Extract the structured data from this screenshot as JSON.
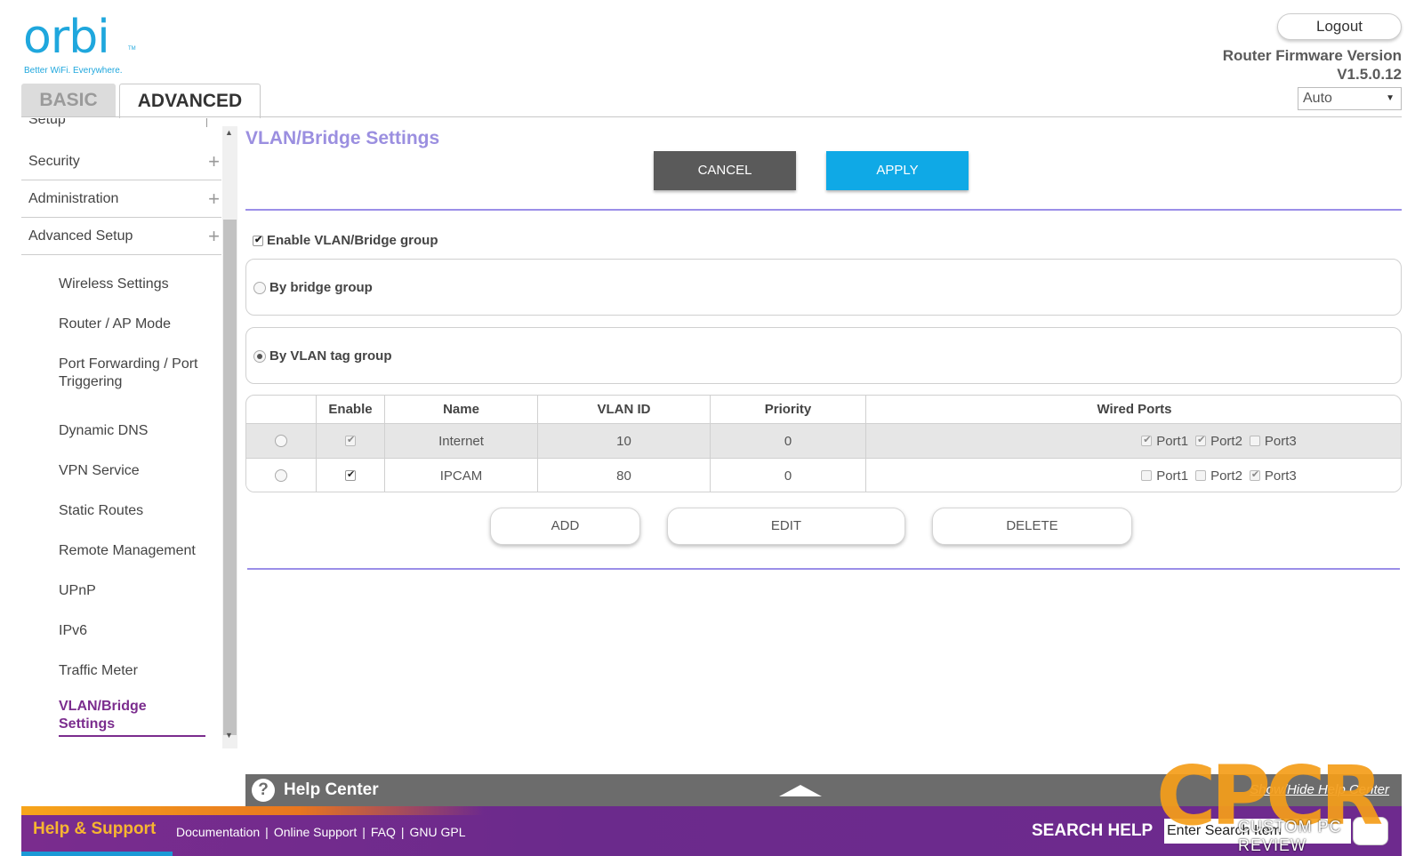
{
  "header": {
    "logo_text": "orbi",
    "logo_tm": "TM",
    "logo_tagline": "Better WiFi. Everywhere.",
    "tabs": [
      {
        "label": "BASIC"
      },
      {
        "label": "ADVANCED"
      }
    ],
    "logout_label": "Logout",
    "firmware_label": "Router Firmware Version",
    "firmware_version": "V1.5.0.12",
    "language_value": "Auto"
  },
  "sidebar": {
    "cut_item": "Setup",
    "main_items": [
      {
        "label": "Security"
      },
      {
        "label": "Administration"
      },
      {
        "label": "Advanced Setup"
      }
    ],
    "sub_items": [
      {
        "label": "Wireless Settings"
      },
      {
        "label": "Router / AP Mode"
      },
      {
        "label": "Port Forwarding / Port Triggering"
      },
      {
        "label": "Dynamic DNS"
      },
      {
        "label": "VPN Service"
      },
      {
        "label": "Static Routes"
      },
      {
        "label": "Remote Management"
      },
      {
        "label": "UPnP"
      },
      {
        "label": "IPv6"
      },
      {
        "label": "Traffic Meter"
      },
      {
        "label": "VLAN/Bridge Settings"
      }
    ]
  },
  "main": {
    "title": "VLAN/Bridge Settings",
    "cancel_label": "CANCEL",
    "apply_label": "APPLY",
    "enable_group_label": "Enable VLAN/Bridge group",
    "enable_group_checked": true,
    "by_bridge_label": "By bridge group",
    "by_vlan_label": "By VLAN tag group",
    "selected_mode": "vlan",
    "table": {
      "headers": [
        "",
        "Enable",
        "Name",
        "VLAN ID",
        "Priority",
        "Wired Ports"
      ],
      "rows": [
        {
          "enabled": true,
          "name": "Internet",
          "vlan_id": "10",
          "priority": "0",
          "ports": [
            {
              "label": "Port1",
              "checked": true
            },
            {
              "label": "Port2",
              "checked": true
            },
            {
              "label": "Port3",
              "checked": false
            }
          ]
        },
        {
          "enabled": true,
          "name": "IPCAM",
          "vlan_id": "80",
          "priority": "0",
          "ports": [
            {
              "label": "Port1",
              "checked": false
            },
            {
              "label": "Port2",
              "checked": false
            },
            {
              "label": "Port3",
              "checked": true
            }
          ]
        }
      ]
    },
    "add_label": "ADD",
    "edit_label": "EDIT",
    "delete_label": "DELETE"
  },
  "help_center": {
    "icon": "question-icon",
    "title": "Help Center",
    "toggle_label": "Show/Hide Help Center"
  },
  "footer": {
    "help_support": "Help & Support",
    "links": [
      "Documentation",
      "Online Support",
      "FAQ",
      "GNU GPL"
    ],
    "search_help": "SEARCH HELP",
    "search_value": "Enter Search Item"
  },
  "watermark": {
    "letters": "CPCR",
    "text": "CUSTOM PC REVIEW"
  },
  "colors": {
    "brand_blue": "#1fa7dd",
    "title_purple": "#9b8fe0",
    "apply_blue": "#0fa9e6",
    "cancel_gray": "#5a5a5a",
    "footer_purple": "#6b2a8c",
    "active_purple": "#7b2d8e"
  }
}
